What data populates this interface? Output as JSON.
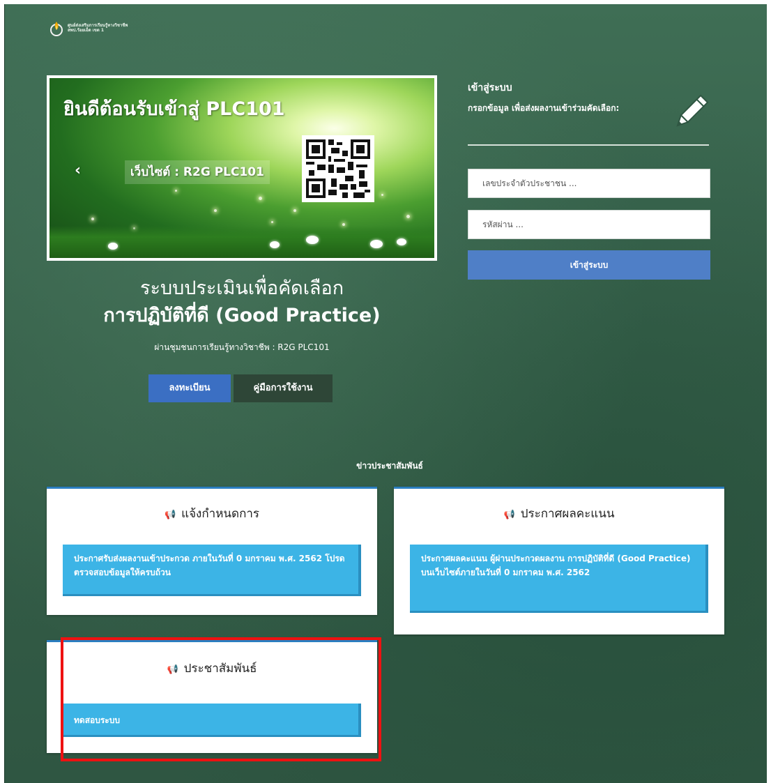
{
  "logo": {
    "line1": "ศูนย์ส่งเสริมการเรียนรู้ทางวิชาชีพ",
    "line2": "สพป.ร้อยเอ็ด เขต 1"
  },
  "banner": {
    "title": "ยินดีต้อนรับเข้าสู่ PLC101",
    "caption": "เว็บไซต์ : R2G PLC101",
    "prev_icon": "chevron-left-icon"
  },
  "system": {
    "title": "ระบบประเมินเพื่อคัดเลือก",
    "subtitle": "การปฏิบัติที่ดี (Good Practice)",
    "note": "ผ่านชุมชนการเรียนรู้ทางวิชาชีพ : R2G PLC101",
    "register_label": "ลงทะเบียน",
    "manual_label": "คู่มือการใช้งาน"
  },
  "login": {
    "heading": "เข้าสู่ระบบ",
    "description": "กรอกข้อมูล เพื่อส่งผลงานเข้าร่วมคัดเลือก:",
    "id_placeholder": "เลขประจำตัวประชาชน ...",
    "password_placeholder": "รหัสผ่าน ...",
    "submit_label": "เข้าสู่ระบบ",
    "icon": "pencil-icon"
  },
  "news": {
    "heading": "ข่าวประชาสัมพันธ์",
    "cards": [
      {
        "icon": "megaphone-icon",
        "title": "แจ้งกำหนดการ",
        "body": "ประกาศรับส่งผลงานเข้าประกวด ภายในวันที่ 0 มกราคม พ.ศ. 2562 โปรดตรวจสอบข้อมูลให้ครบถ้วน"
      },
      {
        "icon": "megaphone-icon",
        "title": "ประกาศผลคะแนน",
        "body": "ประกาศผลคะแนน ผู้ผ่านประกวดผลงาน การปฏิบัติที่ดี (Good Practice) บนเว็บไซต์ภายในวันที่ 0 มกราคม พ.ศ. 2562"
      },
      {
        "icon": "megaphone-icon",
        "title": "ประชาสัมพันธ์",
        "body": "ทดสอบระบบ"
      }
    ]
  },
  "colors": {
    "background": "#355f49",
    "primary_button": "#3b6fc3",
    "card_body": "#3cb4e6",
    "highlight": "#ee1111"
  }
}
